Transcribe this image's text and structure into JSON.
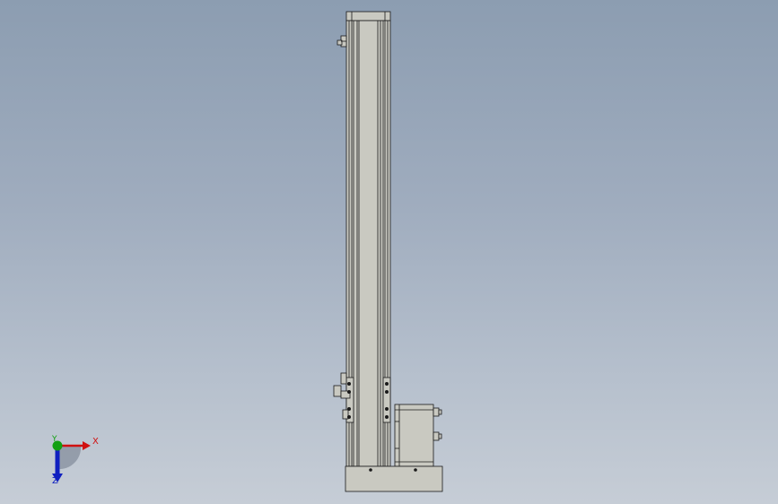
{
  "viewport": {
    "background_top": "#8c9db1",
    "background_bottom": "#c6cdd6"
  },
  "model": {
    "body_color": "#c9c9c1",
    "edge_color": "#1a1a1a"
  },
  "triad": {
    "x_label": "X",
    "y_label": "Y",
    "z_label": "Z",
    "x_color": "#d01010",
    "y_color": "#12a012",
    "z_color": "#1020c0"
  }
}
